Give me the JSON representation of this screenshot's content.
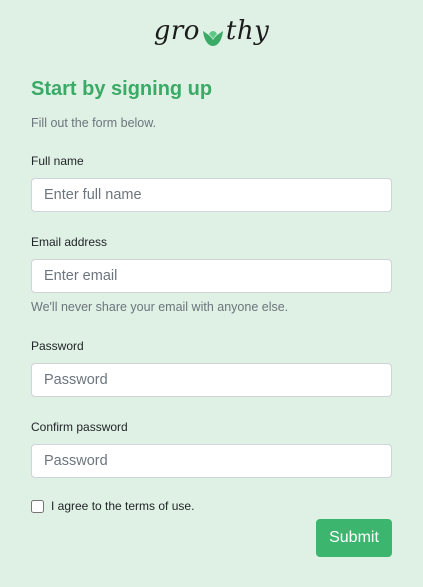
{
  "brand": {
    "logo_left": "gro",
    "logo_right": "thy"
  },
  "header": {
    "title": "Start by signing up",
    "subtitle": "Fill out the form below."
  },
  "form": {
    "full_name": {
      "label": "Full name",
      "placeholder": "Enter full name",
      "value": ""
    },
    "email": {
      "label": "Email address",
      "placeholder": "Enter email",
      "value": "",
      "help": "We'll never share your email with anyone else."
    },
    "password": {
      "label": "Password",
      "placeholder": "Password",
      "value": ""
    },
    "confirm_password": {
      "label": "Confirm password",
      "placeholder": "Password",
      "value": ""
    },
    "terms": {
      "label": "I agree to the terms of use.",
      "checked": false
    },
    "submit_label": "Submit"
  },
  "colors": {
    "background": "#dff0e4",
    "accent": "#3aaa66",
    "button": "#3cb66e"
  },
  "icons": {
    "logo_leaf": "tulip-leaf-icon"
  }
}
